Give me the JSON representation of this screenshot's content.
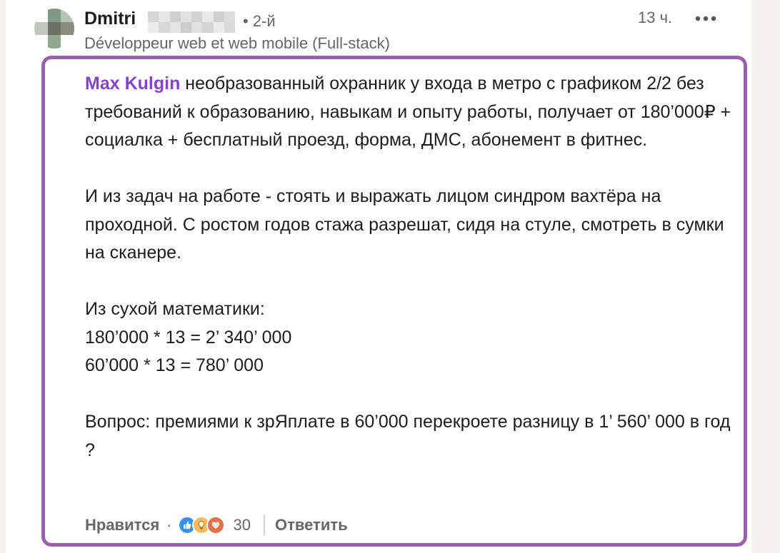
{
  "author": {
    "name": "Dmitri",
    "degree": "• 2-й",
    "headline": "Développeur web et web mobile (Full-stack)",
    "time": "13 ч.",
    "more_icon": "more-horizontal-icon"
  },
  "comment": {
    "mention": "Max Kulgin",
    "paragraph1_rest": " необразованный охранник у входа в метро с графиком 2/2 без требований к образованию, навыкам и опыту работы, получает от 180’000₽ + социалка + бесплатный проезд, форма, ДМС, абонемент в фитнес.",
    "paragraph2": "И из задач на работе - стоять и выражать лицом синдром вахтёра на проходной. С ростом годов стажа разрешат, сидя на стуле, смотреть в сумки на сканере.",
    "paragraph3_lines": [
      "Из сухой математики:",
      "180’000 * 13 = 2’ 340’ 000",
      "60’000 * 13 = 780’ 000"
    ],
    "paragraph4": "Вопрос: премиями к зрЯплате в 60’000 перекроете разницу в 1’ 560’ 000 в год ?"
  },
  "actions": {
    "like_label": "Нравится",
    "separator": "·",
    "reactions": [
      "like-reaction-icon",
      "insightful-reaction-icon",
      "love-reaction-icon"
    ],
    "reaction_count": "30",
    "reply_label": "Ответить"
  },
  "colors": {
    "highlight_outline": "#9b5fb0",
    "mention": "#8344cc",
    "secondary_text": "#666666"
  }
}
